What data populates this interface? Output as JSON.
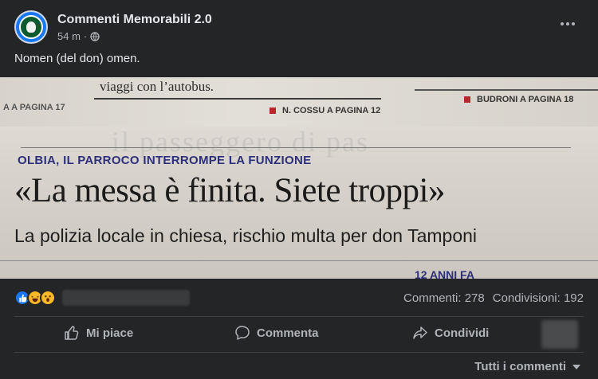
{
  "post": {
    "page_name": "Commenti Memorabili 2.0",
    "timestamp": "54 m",
    "separator": "·",
    "privacy_icon": "globe-icon",
    "caption": "Nomen (del don) omen."
  },
  "photo": {
    "top_line": "viaggi con l’autobus.",
    "ref_left": "A A PAGINA 17",
    "ref_mid": "N. COSSU A PAGINA 12",
    "ref_right": "BUDRONI A PAGINA 18",
    "kicker": "OLBIA, IL PARROCO INTERROMPE LA FUNZIONE",
    "headline": "«La messa è finita. Siete troppi»",
    "subhead": "La polizia locale in chiesa, rischio multa per don Tamponi",
    "cut_text": "12 ANNI FA",
    "ghost_text": "il passeggero di pas"
  },
  "stats": {
    "reaction_icons": [
      "like-icon",
      "haha-icon",
      "wow-icon"
    ],
    "comments": "Commenti: 278",
    "shares": "Condivisioni: 192"
  },
  "actions": {
    "like": "Mi piace",
    "comment": "Commenta",
    "share": "Condividi"
  },
  "footer": {
    "all_comments": "Tutti i commenti"
  },
  "colors": {
    "background": "#242526",
    "text_primary": "#e4e6eb",
    "text_secondary": "#b0b3b8",
    "like_blue": "#1877f2",
    "reaction_yellow": "#f7b928",
    "kicker_blue": "#2d2f7a"
  }
}
